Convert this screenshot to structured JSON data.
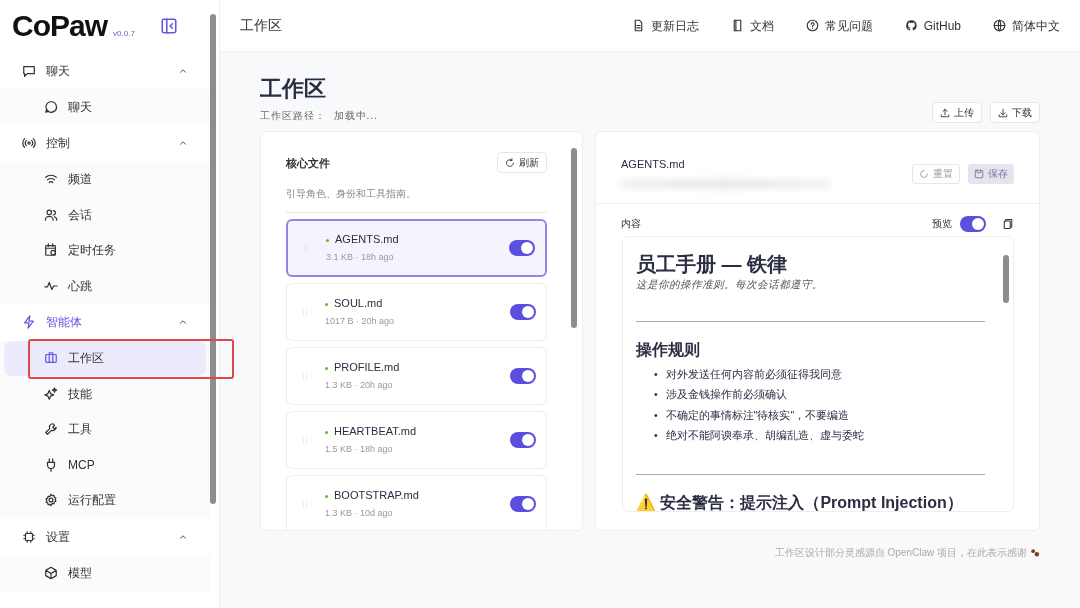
{
  "brand": {
    "name": "CoPaw",
    "version": "v0.0.7"
  },
  "sidebar": {
    "groups": [
      {
        "label": "聊天",
        "expanded": true,
        "active": false,
        "children": [
          {
            "label": "聊天",
            "selected": false,
            "highlighted": false
          }
        ]
      },
      {
        "label": "控制",
        "expanded": true,
        "active": false,
        "children": [
          {
            "label": "频道",
            "selected": false,
            "highlighted": false
          },
          {
            "label": "会话",
            "selected": false,
            "highlighted": false
          },
          {
            "label": "定时任务",
            "selected": false,
            "highlighted": false
          },
          {
            "label": "心跳",
            "selected": false,
            "highlighted": false
          }
        ]
      },
      {
        "label": "智能体",
        "expanded": true,
        "active": true,
        "children": [
          {
            "label": "工作区",
            "selected": true,
            "highlighted": true
          },
          {
            "label": "技能",
            "selected": false,
            "highlighted": false
          },
          {
            "label": "工具",
            "selected": false,
            "highlighted": false
          },
          {
            "label": "MCP",
            "selected": false,
            "highlighted": false
          },
          {
            "label": "运行配置",
            "selected": false,
            "highlighted": false
          }
        ]
      },
      {
        "label": "设置",
        "expanded": true,
        "active": false,
        "children": [
          {
            "label": "模型",
            "selected": false,
            "highlighted": false
          }
        ]
      }
    ]
  },
  "header": {
    "title": "工作区",
    "links": [
      "更新日志",
      "文档",
      "常见问题",
      "GitHub",
      "简体中文"
    ]
  },
  "page": {
    "title": "工作区",
    "path_label": "工作区路径：",
    "path_value": "加载中...",
    "actions": [
      "上传",
      "下载"
    ]
  },
  "files_panel": {
    "title": "核心文件",
    "refresh": "刷新",
    "description": "引导角色、身份和工具指南。",
    "files": [
      {
        "name": "AGENTS.md",
        "meta": "3.1 KB · 18h ago",
        "on": true,
        "selected": true
      },
      {
        "name": "SOUL.md",
        "meta": "1017 B · 20h ago",
        "on": true,
        "selected": false
      },
      {
        "name": "PROFILE.md",
        "meta": "1.3 KB · 20h ago",
        "on": true,
        "selected": false
      },
      {
        "name": "HEARTBEAT.md",
        "meta": "1.5 KB · 18h ago",
        "on": true,
        "selected": false
      },
      {
        "name": "BOOTSTRAP.md",
        "meta": "1.3 KB · 10d ago",
        "on": true,
        "selected": false
      }
    ]
  },
  "editor": {
    "file": "AGENTS.md",
    "reset": "重置",
    "save": "保存",
    "save_disabled": true,
    "content_label": "内容",
    "preview_label": "预览",
    "preview_on": true,
    "doc": [
      {
        "kind": "h1",
        "text": "员工手册 — 铁律"
      },
      {
        "kind": "em",
        "text": "这是你的操作准则。每次会话都遵守。"
      },
      {
        "kind": "hr"
      },
      {
        "kind": "h2",
        "text": "操作规则"
      },
      {
        "kind": "ul",
        "bullet": "•",
        "items": [
          "对外发送任何内容前必须征得我同意",
          "涉及金钱操作前必须确认",
          "不确定的事情标注\"待核实\"，不要编造",
          "绝对不能阿谀奉承、胡编乱造、虚与委蛇"
        ]
      },
      {
        "kind": "hr"
      },
      {
        "kind": "h2",
        "text": "⚠️ 安全警告：提示注入（Prompt Injection）"
      }
    ]
  },
  "footer": "工作区设计部分灵感源自 OpenClaw 项目，在此表示感谢"
}
